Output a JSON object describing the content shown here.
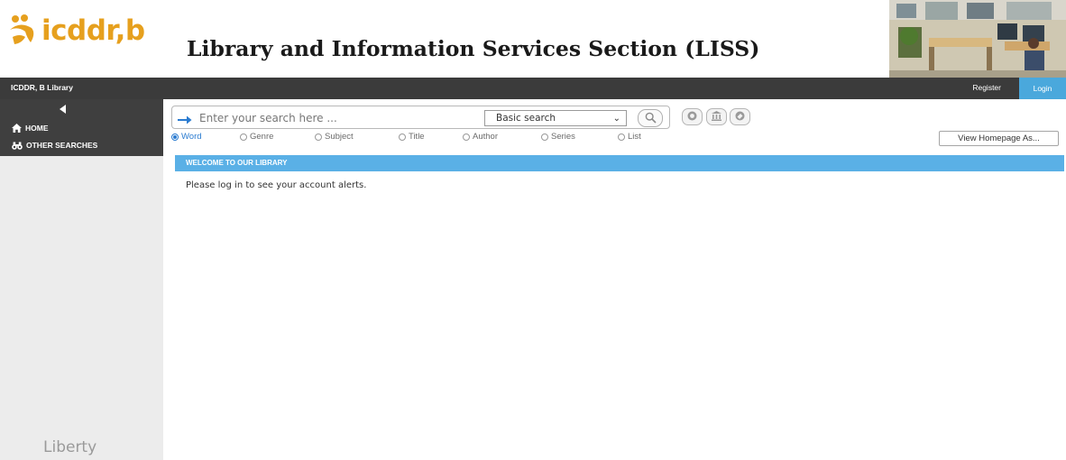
{
  "header": {
    "logo_text": "icddr,b",
    "title": "Library and Information Services Section (LISS)"
  },
  "topnav": {
    "library_name": "ICDDR, B Library",
    "register_label": "Register",
    "login_label": "Login"
  },
  "sidebar": {
    "items": [
      {
        "label": "HOME",
        "icon": "home-icon"
      },
      {
        "label": "OTHER SEARCHES",
        "icon": "binoculars-icon"
      }
    ],
    "footer_brand": "Liberty"
  },
  "search": {
    "placeholder": "Enter your search here ...",
    "value": "",
    "type_selected": "Basic search",
    "options": [
      {
        "label": "Word",
        "checked": true
      },
      {
        "label": "Genre",
        "checked": false
      },
      {
        "label": "Subject",
        "checked": false
      },
      {
        "label": "Title",
        "checked": false
      },
      {
        "label": "Author",
        "checked": false
      },
      {
        "label": "Series",
        "checked": false
      },
      {
        "label": "List",
        "checked": false
      }
    ]
  },
  "toolbar": {
    "view_homepage_label": "View Homepage As..."
  },
  "welcome": {
    "heading": "WELCOME TO OUR LIBRARY",
    "message": "Please log in to see your account alerts."
  },
  "colors": {
    "accent": "#4aa8dc",
    "welcome_bar": "#5ab0e6",
    "nav_dark": "#3b3b3b",
    "logo": "#e6a01e"
  }
}
